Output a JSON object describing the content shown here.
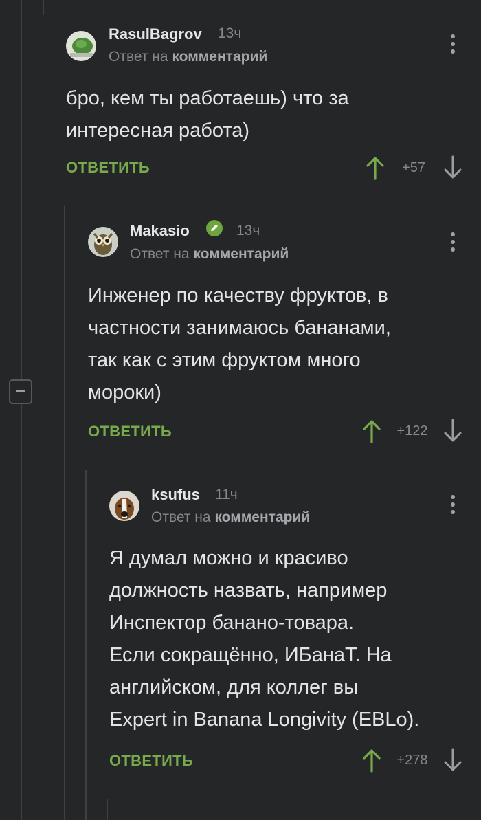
{
  "comments": [
    {
      "author": "RasulBagrov",
      "time": "13ч",
      "reply_prefix": "Ответ на",
      "reply_target": "комментарий",
      "text_lines": [
        "бро, кем ты работаешь) что за",
        "интересная работа)"
      ],
      "reply_label": "ОТВЕТИТЬ",
      "rating": "+57"
    },
    {
      "author": "Makasio",
      "time": "13ч",
      "reply_prefix": "Ответ на",
      "reply_target": "комментарий",
      "text_lines": [
        "Инженер по качеству фруктов, в",
        "частности занимаюсь бананами,",
        "так как с этим фруктом много",
        "мороки)"
      ],
      "reply_label": "ОТВЕТИТЬ",
      "rating": "+122"
    },
    {
      "author": "ksufus",
      "time": "11ч",
      "reply_prefix": "Ответ на",
      "reply_target": "комментарий",
      "text_lines": [
        "Я думал можно и красиво",
        "должность назвать, например",
        "Инспектор банано-товара.",
        "Если сокращённо, ИБанаТ. На",
        "английском, для коллег вы",
        "Expert in Banana Longivity (EBLo)."
      ],
      "reply_label": "ОТВЕТИТЬ",
      "rating": "+278"
    }
  ],
  "colors": {
    "background": "#242628",
    "accent": "#79a94d",
    "muted": "#84888c"
  },
  "icons": [
    "kebab-menu-icon",
    "upvote-arrow-icon",
    "downvote-arrow-icon",
    "collapse-thread-icon",
    "verified-badge-icon"
  ]
}
